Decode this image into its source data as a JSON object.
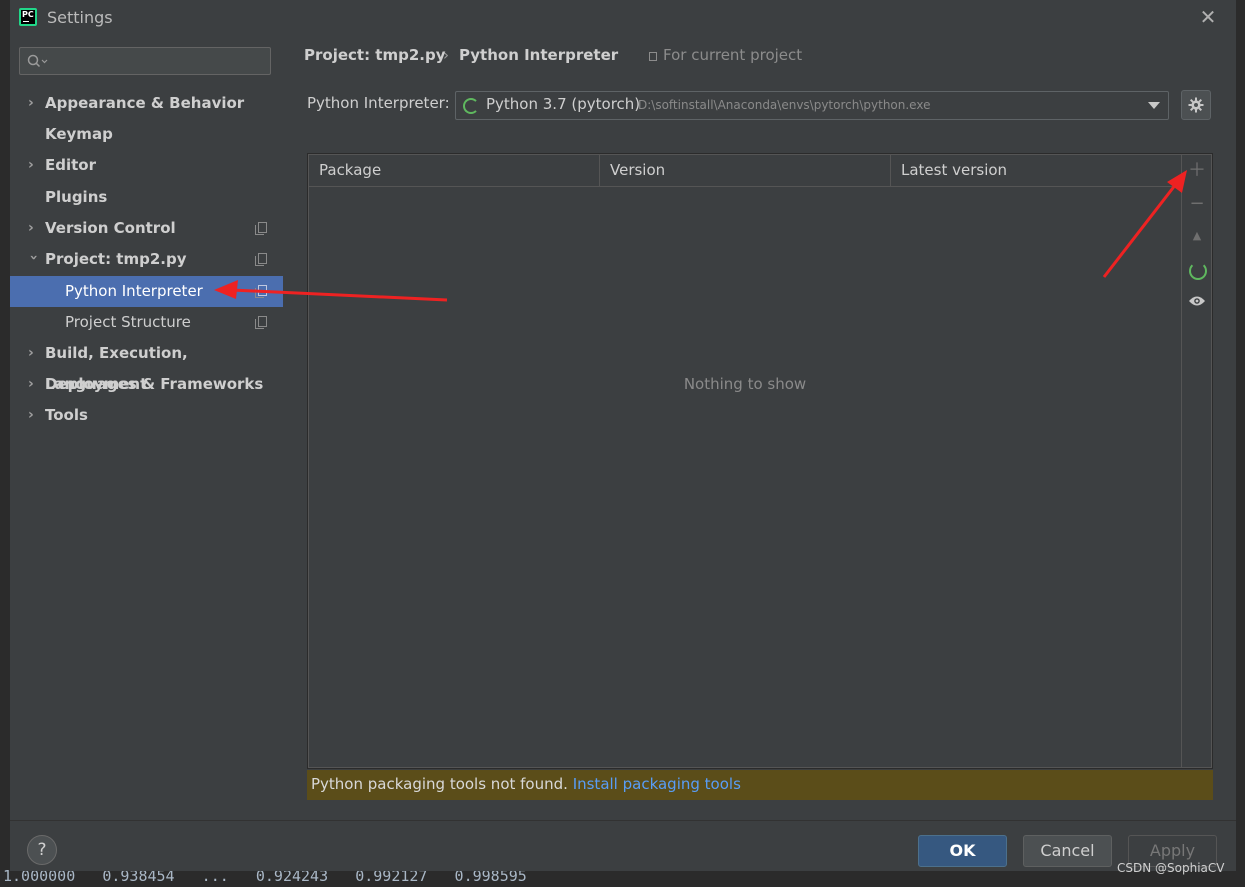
{
  "window": {
    "title": "Settings",
    "app_icon_text": "PC"
  },
  "search": {
    "placeholder": ""
  },
  "sidebar": {
    "items": [
      {
        "label": "Appearance & Behavior",
        "expandable": true
      },
      {
        "label": "Keymap",
        "expandable": false
      },
      {
        "label": "Editor",
        "expandable": true
      },
      {
        "label": "Plugins",
        "expandable": false
      },
      {
        "label": "Version Control",
        "expandable": true
      },
      {
        "label": "Project: tmp2.py",
        "expandable": true,
        "expanded": true
      },
      {
        "label": "Python Interpreter",
        "child": true,
        "selected": true
      },
      {
        "label": "Project Structure",
        "child": true
      },
      {
        "label": "Build, Execution, Deployment",
        "expandable": true
      },
      {
        "label": "Languages & Frameworks",
        "expandable": true
      },
      {
        "label": "Tools",
        "expandable": true
      }
    ]
  },
  "breadcrumb": {
    "project": "Project: tmp2.py",
    "separator": "›",
    "page": "Python Interpreter",
    "scope": "For current project"
  },
  "interpreter": {
    "label": "Python Interpreter:",
    "name": "Python 3.7 (pytorch)",
    "path": "D:\\softinstall\\Anaconda\\envs\\pytorch\\python.exe"
  },
  "packages": {
    "columns": [
      "Package",
      "Version",
      "Latest version"
    ],
    "rows": [],
    "empty_text": "Nothing to show"
  },
  "warning": {
    "text": "Python packaging tools not found.",
    "link": "Install packaging tools"
  },
  "footer": {
    "help": "?",
    "ok": "OK",
    "cancel": "Cancel",
    "apply": "Apply"
  },
  "watermark": "CSDN @SophiaCV",
  "background_code": "1.000000   0.938454   ...   0.924243   0.992127   0.998595",
  "colors": {
    "selection": "#4b6eaf",
    "link": "#589df6",
    "warning_bg": "#5b4d19",
    "annotation_arrow": "#ee2222",
    "ok_button": "#365880"
  }
}
